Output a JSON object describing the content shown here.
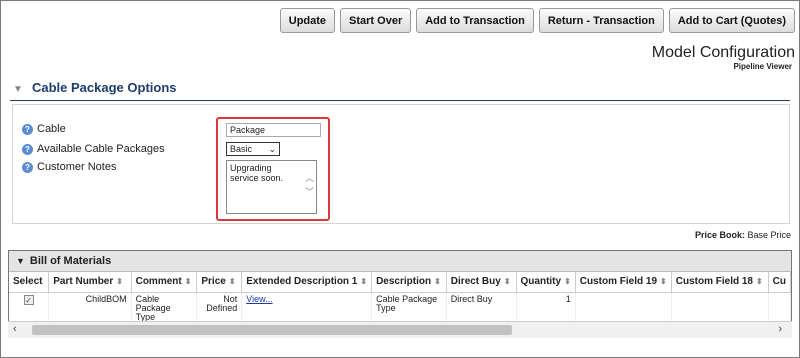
{
  "toolbar": {
    "buttons": [
      "Update",
      "Start Over",
      "Add to Transaction",
      "Return - Transaction",
      "Add to Cart (Quotes)"
    ]
  },
  "header": {
    "title": "Model Configuration",
    "subtitle": "Pipeline Viewer"
  },
  "options": {
    "section_title": "Cable Package Options",
    "fields": [
      {
        "label": "Cable",
        "value": "Package"
      },
      {
        "label": "Available Cable Packages",
        "value": "Basic"
      },
      {
        "label": "Customer Notes",
        "value": "Upgrading service soon."
      }
    ]
  },
  "price_book": {
    "label": "Price Book:",
    "value": "Base Price"
  },
  "bom": {
    "title": "Bill of Materials",
    "columns": [
      "Select",
      "Part Number",
      "Comment",
      "Price",
      "Extended Description 1",
      "Description",
      "Direct Buy",
      "Quantity",
      "Custom Field 19",
      "Custom Field 18",
      "Cu"
    ],
    "rows": [
      {
        "part_number": "ChildBOM",
        "comment": "Cable Package Type",
        "price": "Not Defined",
        "extended_description": "View...",
        "description": "Cable Package Type",
        "direct_buy": "Direct Buy",
        "quantity": "1"
      }
    ]
  },
  "icons": {
    "info": "info-circle-icon",
    "collapse": "triangle-down-icon",
    "sort": "sort-arrows-icon"
  },
  "colors": {
    "section_title": "#1d3d6b",
    "highlight_box": "#d9393b",
    "info_icon": "#5b8dd0",
    "link": "#1a3d9e"
  }
}
